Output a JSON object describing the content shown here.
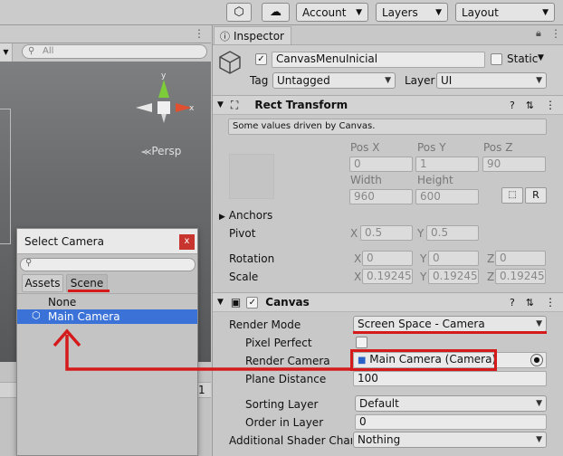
{
  "toolbar": {
    "account_label": "Account",
    "layers_label": "Layers",
    "layout_label": "Layout"
  },
  "scene": {
    "search_placeholder": "All",
    "persp_label": "Persp",
    "gizmo_y": "y",
    "gizmo_x": "x",
    "lower_value": "1"
  },
  "inspector": {
    "tab_label": "Inspector",
    "object_name": "CanvasMenuInicial",
    "static_label": "Static",
    "tag_label": "Tag",
    "tag_value": "Untagged",
    "layer_label": "Layer",
    "layer_value": "UI",
    "rect_transform": {
      "title": "Rect Transform",
      "note": "Some values driven by Canvas.",
      "pos_x_label": "Pos X",
      "pos_y_label": "Pos Y",
      "pos_z_label": "Pos Z",
      "pos_x": "0",
      "pos_y": "1",
      "pos_z": "90",
      "width_label": "Width",
      "height_label": "Height",
      "width": "960",
      "height": "600",
      "r_button": "R",
      "anchors_label": "Anchors",
      "pivot_label": "Pivot",
      "pivot_x": "0.5",
      "pivot_y": "0.5",
      "rotation_label": "Rotation",
      "rot_x": "0",
      "rot_y": "0",
      "rot_z": "0",
      "scale_label": "Scale",
      "scale_x": "0.192450",
      "scale_y": "0.192450",
      "scale_z": "0.192450",
      "x": "X",
      "y": "Y",
      "z": "Z"
    },
    "canvas": {
      "title": "Canvas",
      "render_mode_label": "Render Mode",
      "render_mode_value": "Screen Space - Camera",
      "pixel_perfect_label": "Pixel Perfect",
      "render_camera_label": "Render Camera",
      "render_camera_value": "Main Camera (Camera)",
      "plane_distance_label": "Plane Distance",
      "plane_distance_value": "100",
      "sorting_layer_label": "Sorting Layer",
      "sorting_layer_value": "Default",
      "order_in_layer_label": "Order in Layer",
      "order_in_layer_value": "0",
      "shader_channels_label": "Additional Shader Chann",
      "shader_channels_value": "Nothing"
    }
  },
  "dialog": {
    "title": "Select Camera",
    "close": "x",
    "tab_assets": "Assets",
    "tab_scene": "Scene",
    "items": [
      "None",
      "Main Camera"
    ]
  },
  "colors": {
    "annotation_red": "#d41a1a",
    "selection_blue": "#3a72d8"
  }
}
